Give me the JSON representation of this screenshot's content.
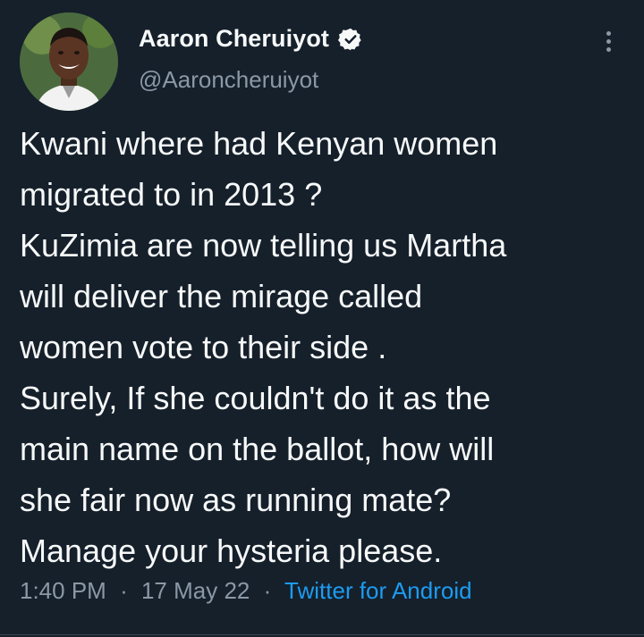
{
  "author": {
    "display_name": "Aaron Cheruiyot",
    "handle": "@Aaroncheruiyot",
    "verified": true
  },
  "tweet": {
    "lines": [
      "Kwani where had Kenyan women",
      "migrated to in 2013 ?",
      "KuZimia are now telling us Martha",
      "will deliver the mirage called",
      "women vote to their side .",
      "Surely, If she couldn't do it as the",
      "main name on the ballot, how will",
      "she fair now as running mate?",
      "Manage your hysteria please."
    ]
  },
  "meta": {
    "time": "1:40 PM",
    "date": "17 May 22",
    "separator": "·",
    "source": "Twitter for Android"
  },
  "icons": {
    "verified": "verified-badge-icon",
    "more": "more-vertical-icon"
  },
  "colors": {
    "background": "#15202b",
    "text_primary": "#f7f9f9",
    "text_secondary": "#8b98a5",
    "accent": "#1d9bf0"
  }
}
